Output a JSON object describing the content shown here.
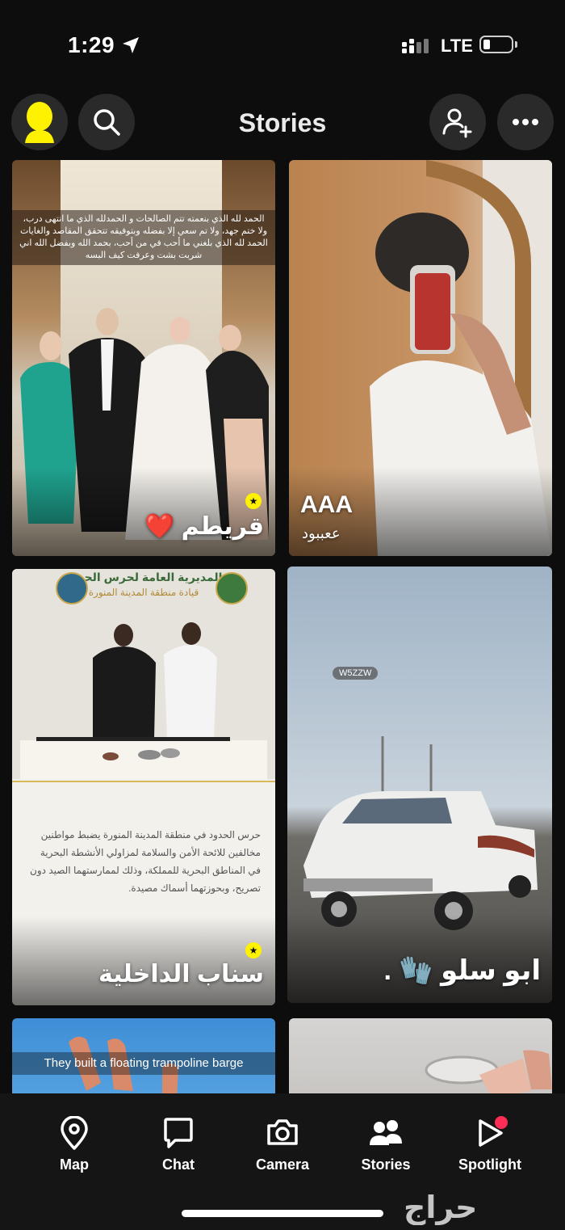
{
  "status_bar": {
    "time": "1:29",
    "network": "LTE"
  },
  "header": {
    "title": "Stories"
  },
  "stories": [
    {
      "overlay_text": "الحمد لله الذي بنعمته تتم الصالحات و الحمدلله الذي ما انتهى درب، ولا ختم جهد، ولا تم سعي إلا بفضله وبتوفيقه تتحقق المقاصد والغايات الحمد لله الذي بلغني ما أحب في من أحب، بحمد الله وبفضل الله اني شربت بشت وعرفت كيف البسه",
      "name": "قريطم",
      "emoji": "❤️"
    },
    {
      "name": "AAA",
      "subtitle": "ععببود"
    },
    {
      "header_line1": "المديرية العامة لحرس الحدود",
      "header_line2": "قيادة منطقة المدينة المنورة",
      "body": "حرس الحدود في منطقة المدينة المنورة يضبط مواطنين مخالفين للائحة الأمن والسلامة لمزاولي الأنشطة البحرية في المناطق البحرية للمملكة، وذلك لممارستهما الصيد دون تصريح، وبحوزتهما أسماك مصيدة.",
      "name": "سناب الداخلية"
    },
    {
      "tag": "W5ZZW",
      "name": "ابو سلو",
      "emoji": "🧤",
      "dot": "."
    },
    {
      "overlay_text": "They built a floating trampoline barge"
    },
    {}
  ],
  "nav": {
    "items": [
      {
        "label": "Map"
      },
      {
        "label": "Chat"
      },
      {
        "label": "Camera"
      },
      {
        "label": "Stories"
      },
      {
        "label": "Spotlight"
      }
    ]
  },
  "watermark": "حراج",
  "colors": {
    "background": "#0d0d0d",
    "nav_bg": "#151515",
    "bitmoji": "#fff200",
    "notify_dot": "#ff2d55"
  }
}
